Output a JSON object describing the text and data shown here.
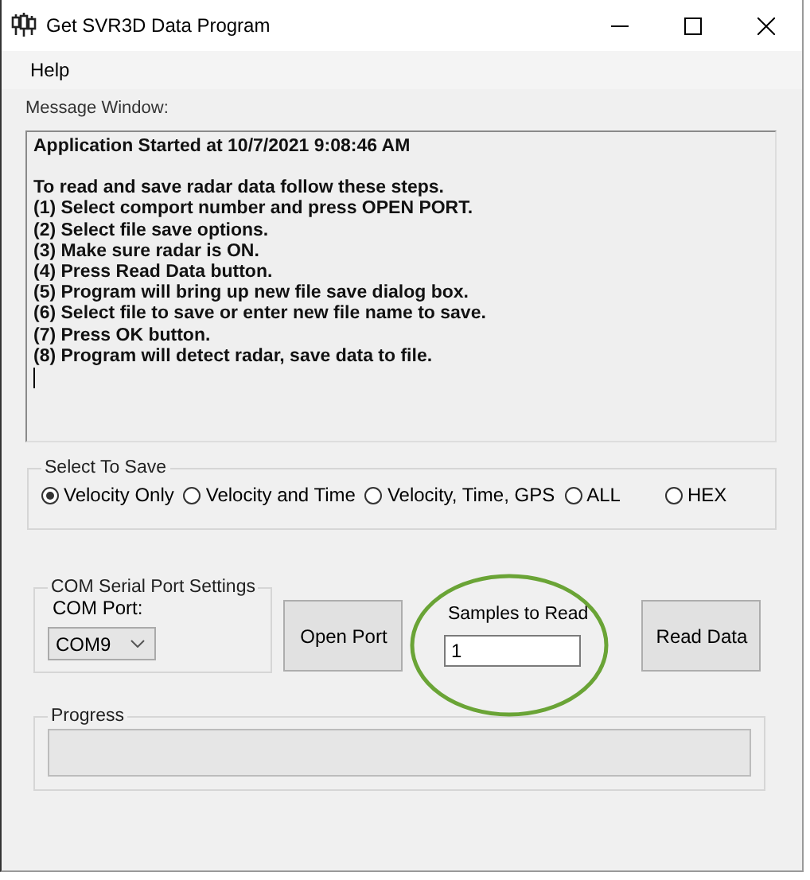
{
  "window": {
    "title": "Get SVR3D Data Program"
  },
  "menu": [
    "Help"
  ],
  "message_window": {
    "label": "Message Window:",
    "header": "Application Started at 10/7/2021 9:08:46 AM",
    "lines": [
      "To read and save radar data follow these steps.",
      "(1) Select comport number and press OPEN PORT.",
      "(2) Select file save options.",
      "(3) Make sure radar is ON.",
      "(4) Press Read Data button.",
      "(5) Program will bring up new file save dialog box.",
      "(6) Select file to save or enter new file name to save.",
      "(7) Press OK button.",
      "(8) Program will detect radar, save data to file."
    ]
  },
  "select_to_save": {
    "title": "Select To Save",
    "options": [
      {
        "label": "Velocity Only",
        "selected": true
      },
      {
        "label": "Velocity and Time",
        "selected": false
      },
      {
        "label": "Velocity, Time, GPS",
        "selected": false
      },
      {
        "label": "ALL",
        "selected": false
      },
      {
        "label": "HEX",
        "selected": false
      }
    ]
  },
  "com_settings": {
    "title": "COM Serial Port Settings",
    "port_label": "COM Port:",
    "port_value": "COM9"
  },
  "open_port_button": "Open Port",
  "samples": {
    "label": "Samples to Read",
    "value": "1"
  },
  "read_data_button": "Read Data",
  "progress": {
    "title": "Progress",
    "level": 0
  }
}
